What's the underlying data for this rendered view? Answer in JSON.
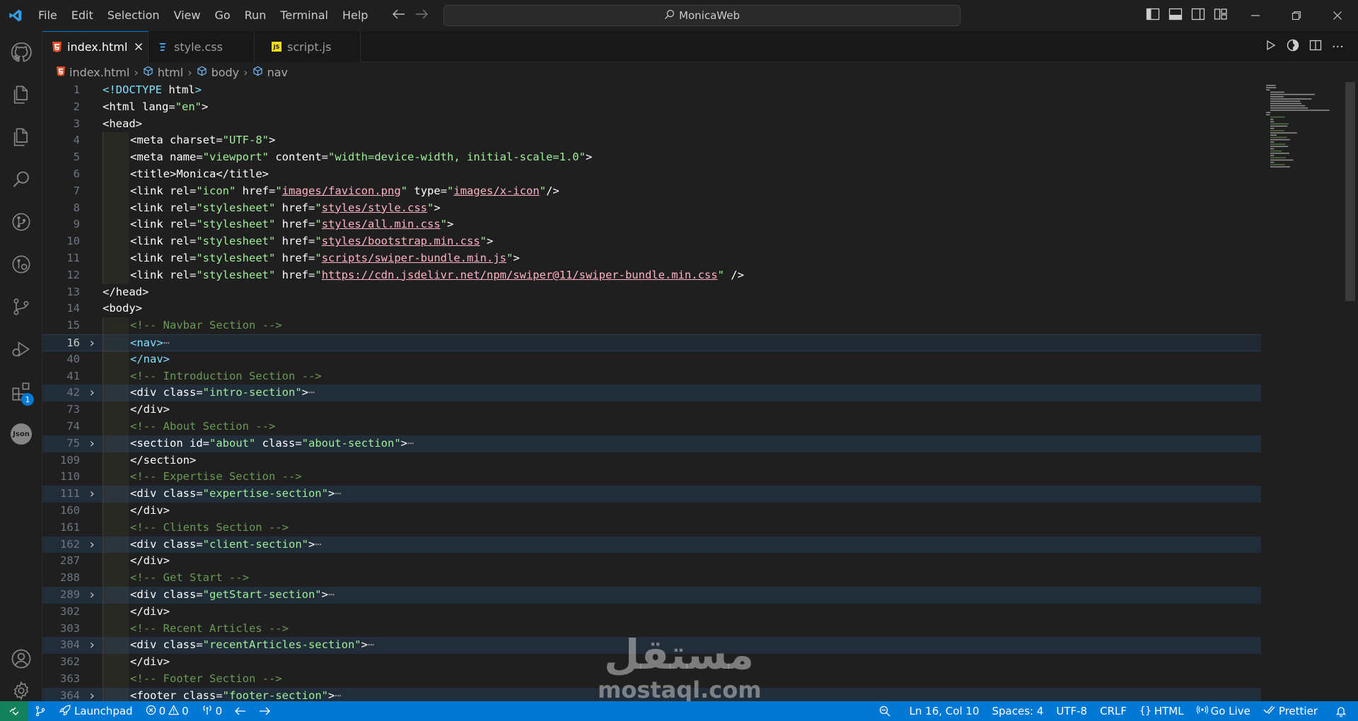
{
  "titlebar": {
    "menu": [
      "File",
      "Edit",
      "Selection",
      "View",
      "Go",
      "Run",
      "Terminal",
      "Help"
    ],
    "search_text": "MonicaWeb"
  },
  "activitybar": {
    "extensions_badge": "1",
    "json_label": "Json"
  },
  "tabs": [
    {
      "label": "index.html",
      "icon": "html5-icon",
      "active": true
    },
    {
      "label": "style.css",
      "icon": "css-icon",
      "active": false
    },
    {
      "label": "script.js",
      "icon": "js-icon",
      "active": false
    }
  ],
  "breadcrumb": [
    "index.html",
    "html",
    "body",
    "nav"
  ],
  "editor": {
    "line_numbers": [
      "1",
      "2",
      "3",
      "4",
      "5",
      "6",
      "7",
      "8",
      "9",
      "10",
      "11",
      "12",
      "13",
      "14",
      "15",
      "16",
      "40",
      "41",
      "42",
      "73",
      "74",
      "75",
      "109",
      "110",
      "111",
      "160",
      "161",
      "162",
      "287",
      "288",
      "289",
      "302",
      "303",
      "304",
      "362",
      "363",
      "364"
    ],
    "lines": [
      {
        "n": "1",
        "text": "<!DOCTYPE html>"
      },
      {
        "n": "2",
        "text": "<html lang=\"en\">"
      },
      {
        "n": "3",
        "text": "<head>"
      },
      {
        "n": "4",
        "text": "<meta charset=\"UTF-8\">"
      },
      {
        "n": "5",
        "text": "<meta name=\"viewport\" content=\"width=device-width, initial-scale=1.0\">"
      },
      {
        "n": "6",
        "text": "<title>Monica</title>"
      },
      {
        "n": "7",
        "text": "<link rel=\"icon\" href=\"images/favicon.png\" type=\"images/x-icon\"/>"
      },
      {
        "n": "8",
        "text": "<link rel=\"stylesheet\" href=\"styles/style.css\">"
      },
      {
        "n": "9",
        "text": "<link rel=\"stylesheet\" href=\"styles/all.min.css\">"
      },
      {
        "n": "10",
        "text": "<link rel=\"stylesheet\" href=\"styles/bootstrap.min.css\">"
      },
      {
        "n": "11",
        "text": "<link rel=\"stylesheet\" href=\"scripts/swiper-bundle.min.js\">"
      },
      {
        "n": "12",
        "text": "<link rel=\"stylesheet\" href=\"https://cdn.jsdelivr.net/npm/swiper@11/swiper-bundle.min.css\" />"
      },
      {
        "n": "13",
        "text": "</head>"
      },
      {
        "n": "14",
        "text": "<body>"
      },
      {
        "n": "15",
        "text": "<!-- Navbar Section -->"
      },
      {
        "n": "16",
        "text": "<nav>"
      },
      {
        "n": "40",
        "text": "</nav>"
      },
      {
        "n": "41",
        "text": "<!-- Introduction Section -->"
      },
      {
        "n": "42",
        "text": "<div class=\"intro-section\">"
      },
      {
        "n": "73",
        "text": "</div>"
      },
      {
        "n": "74",
        "text": "<!-- About Section -->"
      },
      {
        "n": "75",
        "text": "<section id=\"about\" class=\"about-section\">"
      },
      {
        "n": "109",
        "text": "</section>"
      },
      {
        "n": "110",
        "text": "<!-- Expertise Section -->"
      },
      {
        "n": "111",
        "text": "<div class=\"expertise-section\">"
      },
      {
        "n": "160",
        "text": "</div>"
      },
      {
        "n": "161",
        "text": "<!-- Clients Section -->"
      },
      {
        "n": "162",
        "text": "<div class=\"client-section\">"
      },
      {
        "n": "287",
        "text": "</div>"
      },
      {
        "n": "288",
        "text": "<!-- Get Start -->"
      },
      {
        "n": "289",
        "text": "<div class=\"getStart-section\">"
      },
      {
        "n": "302",
        "text": "</div>"
      },
      {
        "n": "303",
        "text": "<!-- Recent Articles -->"
      },
      {
        "n": "304",
        "text": "<div class=\"recentArticles-section\">"
      },
      {
        "n": "362",
        "text": "</div>"
      },
      {
        "n": "363",
        "text": "<!-- Footer Section -->"
      },
      {
        "n": "364",
        "text": "<footer class=\"footer-section\">"
      }
    ],
    "fold_ellipsis": "⋯"
  },
  "watermark": {
    "arabic": "مستقل",
    "latin": "mostaql.com"
  },
  "statusbar": {
    "launchpad": "Launchpad",
    "errors": "0",
    "warnings": "0",
    "ports": "0",
    "position": "Ln 16, Col 10",
    "spaces": "Spaces: 4",
    "encoding": "UTF-8",
    "eol": "CRLF",
    "language": "HTML",
    "golive": "Go Live",
    "prettier": "Prettier"
  },
  "colors": {
    "accent": "#0078d4",
    "remote": "#16825d",
    "html_icon": "#e44d26",
    "css_icon": "#42a5f5",
    "js_icon": "#f5de19"
  }
}
